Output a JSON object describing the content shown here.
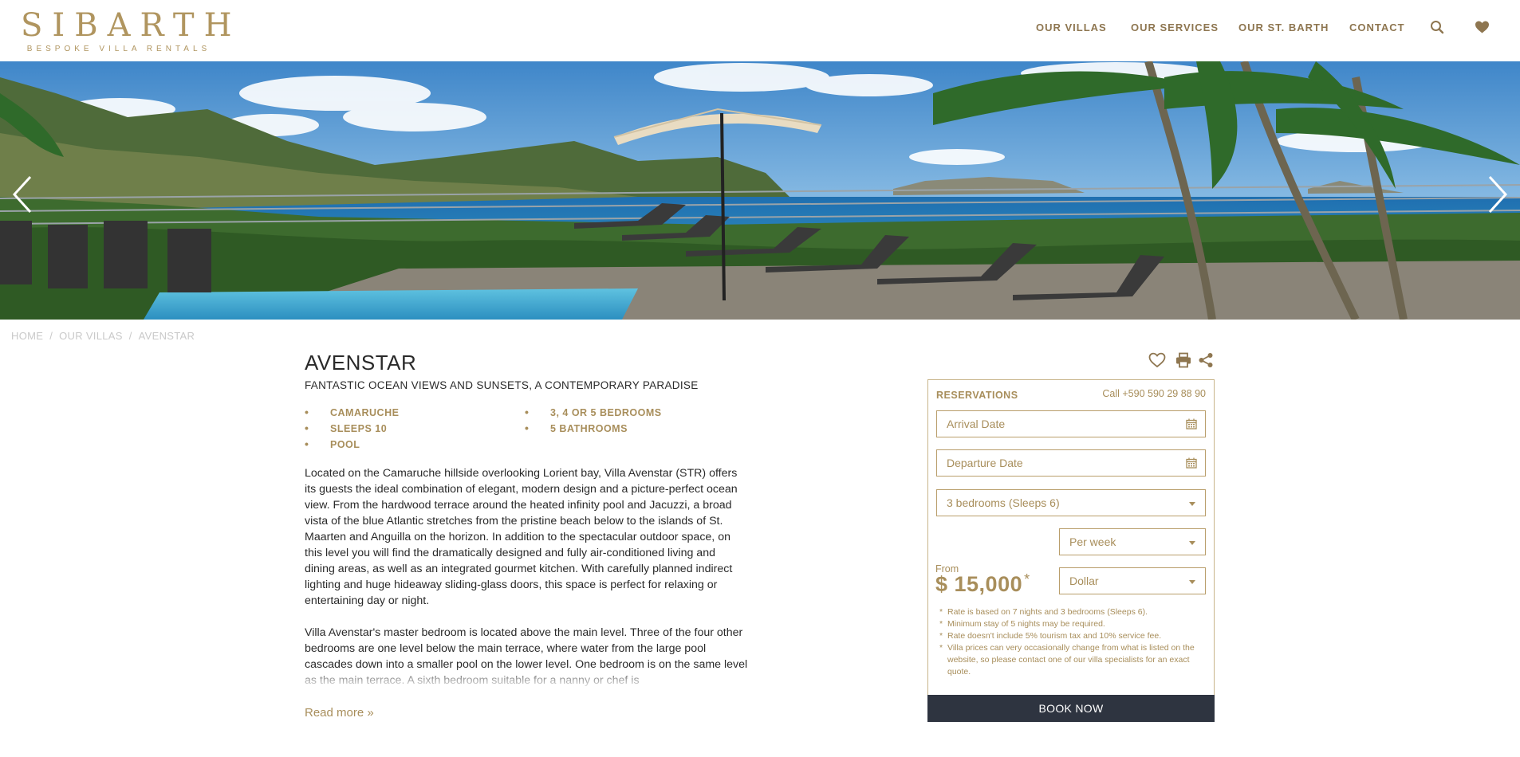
{
  "header": {
    "logo_main": "SIBARTH",
    "logo_sub": "BESPOKE VILLA RENTALS",
    "nav": [
      "OUR VILLAS",
      "OUR SERVICES",
      "OUR ST. BARTH",
      "CONTACT"
    ],
    "icons": [
      "search-icon",
      "heart-icon"
    ]
  },
  "hero": {
    "icons": [
      "chevron-left-icon",
      "chevron-right-icon"
    ]
  },
  "breadcrumb": [
    "HOME",
    "OUR VILLAS",
    "AVENSTAR"
  ],
  "villa": {
    "title": "AVENSTAR",
    "subtitle": "FANTASTIC OCEAN VIEWS AND SUNSETS, A CONTEMPORARY PARADISE",
    "features_left": [
      "CAMARUCHE",
      "SLEEPS 10",
      "POOL"
    ],
    "features_right": [
      "3, 4 OR 5 BEDROOMS",
      "5 BATHROOMS"
    ],
    "description": [
      "Located on the Camaruche hillside overlooking Lorient bay, Villa Avenstar (STR) offers its guests the ideal combination of elegant, modern design and a picture-perfect ocean view. From the hardwood terrace around the heated infinity pool and Jacuzzi, a broad vista of the blue Atlantic stretches from the pristine beach below to the islands of St. Maarten and Anguilla on the horizon. In addition to the spectacular outdoor space, on this level you will find the dramatically designed and fully air-conditioned living and dining areas, as well as an integrated gourmet kitchen. With carefully planned indirect lighting and huge hideaway sliding-glass doors, this space is perfect for relaxing or entertaining day or night.",
      "Villa Avenstar's master bedroom is located above the main level. Three of the four other bedrooms are one level below the main terrace, where water from the large pool cascades down into a smaller pool on the lower level. One bedroom is on the same level as the main terrace. A sixth bedroom suitable for a nanny or chef is"
    ],
    "read_more": "Read more »",
    "action_icons": [
      "heart-outline-icon",
      "print-icon",
      "share-icon"
    ]
  },
  "reservation": {
    "title": "RESERVATIONS",
    "call": "Call +590 590 29 88 90",
    "arrival_placeholder": "Arrival Date",
    "departure_placeholder": "Departure Date",
    "bedrooms_selected": "3 bedrooms (Sleeps 6)",
    "period_selected": "Per week",
    "currency_selected": "Dollar",
    "from_label": "From",
    "price": "$ 15,000",
    "price_mark": "*",
    "notes": [
      "Rate is based on 7 nights and 3 bedrooms (Sleeps 6).",
      "Minimum stay of 5 nights may be required.",
      "Rate doesn't include 5% tourism tax and 10% service fee.",
      "Villa prices can very occasionally change from what is listed on the website, so please contact one of our villa specialists for an exact quote."
    ],
    "book_label": "BOOK NOW"
  },
  "colors": {
    "gold": "#b0955f",
    "dark_button": "#2e3440",
    "text": "#2a2a2a"
  }
}
